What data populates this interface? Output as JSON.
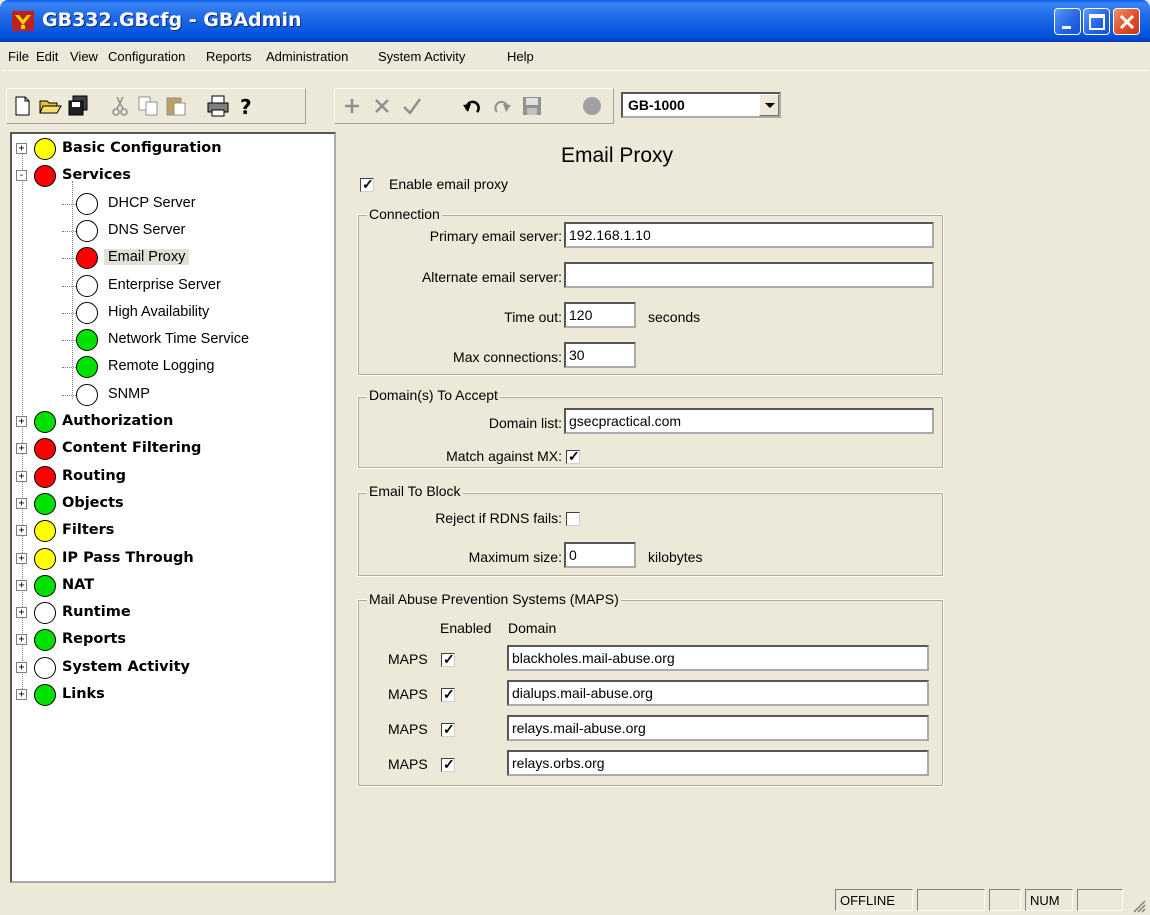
{
  "window": {
    "title": "GB332.GBcfg - GBAdmin",
    "icon": "gb-logo-icon"
  },
  "menu": [
    "File",
    "Edit",
    "View",
    "Configuration",
    "Reports",
    "Administration",
    "System Activity",
    "Help"
  ],
  "toolbar": {
    "device_select": "GB-1000"
  },
  "tree": {
    "items": [
      {
        "label": "Basic Configuration",
        "status": "yellow",
        "level": 0,
        "expander": "+"
      },
      {
        "label": "Services",
        "status": "red",
        "level": 0,
        "expander": "-"
      },
      {
        "label": "DHCP Server",
        "status": "white",
        "level": 1
      },
      {
        "label": "DNS Server",
        "status": "white",
        "level": 1
      },
      {
        "label": "Email Proxy",
        "status": "red",
        "level": 1,
        "selected": true
      },
      {
        "label": "Enterprise Server",
        "status": "white",
        "level": 1
      },
      {
        "label": "High Availability",
        "status": "white",
        "level": 1
      },
      {
        "label": "Network Time Service",
        "status": "green",
        "level": 1
      },
      {
        "label": "Remote Logging",
        "status": "green",
        "level": 1
      },
      {
        "label": "SNMP",
        "status": "white",
        "level": 1
      },
      {
        "label": "Authorization",
        "status": "green",
        "level": 0,
        "expander": "+"
      },
      {
        "label": "Content Filtering",
        "status": "red",
        "level": 0,
        "expander": "+"
      },
      {
        "label": "Routing",
        "status": "red",
        "level": 0,
        "expander": "+"
      },
      {
        "label": "Objects",
        "status": "green",
        "level": 0,
        "expander": "+"
      },
      {
        "label": "Filters",
        "status": "yellow",
        "level": 0,
        "expander": "+"
      },
      {
        "label": "IP Pass Through",
        "status": "yellow",
        "level": 0,
        "expander": "+"
      },
      {
        "label": "NAT",
        "status": "green",
        "level": 0,
        "expander": "+"
      },
      {
        "label": "Runtime",
        "status": "white",
        "level": 0,
        "expander": "+"
      },
      {
        "label": "Reports",
        "status": "green",
        "level": 0,
        "expander": "+"
      },
      {
        "label": "System Activity",
        "status": "white",
        "level": 0,
        "expander": "+"
      },
      {
        "label": "Links",
        "status": "green",
        "level": 0,
        "expander": "+"
      }
    ]
  },
  "form": {
    "heading": "Email Proxy",
    "enable_label": "Enable email proxy",
    "enable_checked": true,
    "connection": {
      "legend": "Connection",
      "primary_label": "Primary email server:",
      "primary_value": "192.168.1.10",
      "alternate_label": "Alternate email server:",
      "alternate_value": "",
      "timeout_label": "Time out:",
      "timeout_value": "120",
      "timeout_unit": "seconds",
      "maxconn_label": "Max connections:",
      "maxconn_value": "30"
    },
    "domains": {
      "legend": "Domain(s) To Accept",
      "list_label": "Domain list:",
      "list_value": "gsecpractical.com",
      "mx_label": "Match against MX:",
      "mx_checked": true
    },
    "block": {
      "legend": "Email To Block",
      "rdns_label": "Reject if RDNS fails:",
      "rdns_checked": false,
      "maxsize_label": "Maximum size:",
      "maxsize_value": "0",
      "maxsize_unit": "kilobytes"
    },
    "maps": {
      "legend": "Mail Abuse Prevention Systems (MAPS)",
      "col_enabled": "Enabled",
      "col_domain": "Domain",
      "rows": [
        {
          "label": "MAPS",
          "checked": true,
          "domain": "blackholes.mail-abuse.org"
        },
        {
          "label": "MAPS",
          "checked": true,
          "domain": "dialups.mail-abuse.org"
        },
        {
          "label": "MAPS",
          "checked": true,
          "domain": "relays.mail-abuse.org"
        },
        {
          "label": "MAPS",
          "checked": true,
          "domain": "relays.orbs.org"
        }
      ]
    }
  },
  "status": {
    "offline": "OFFLINE",
    "num": "NUM"
  }
}
